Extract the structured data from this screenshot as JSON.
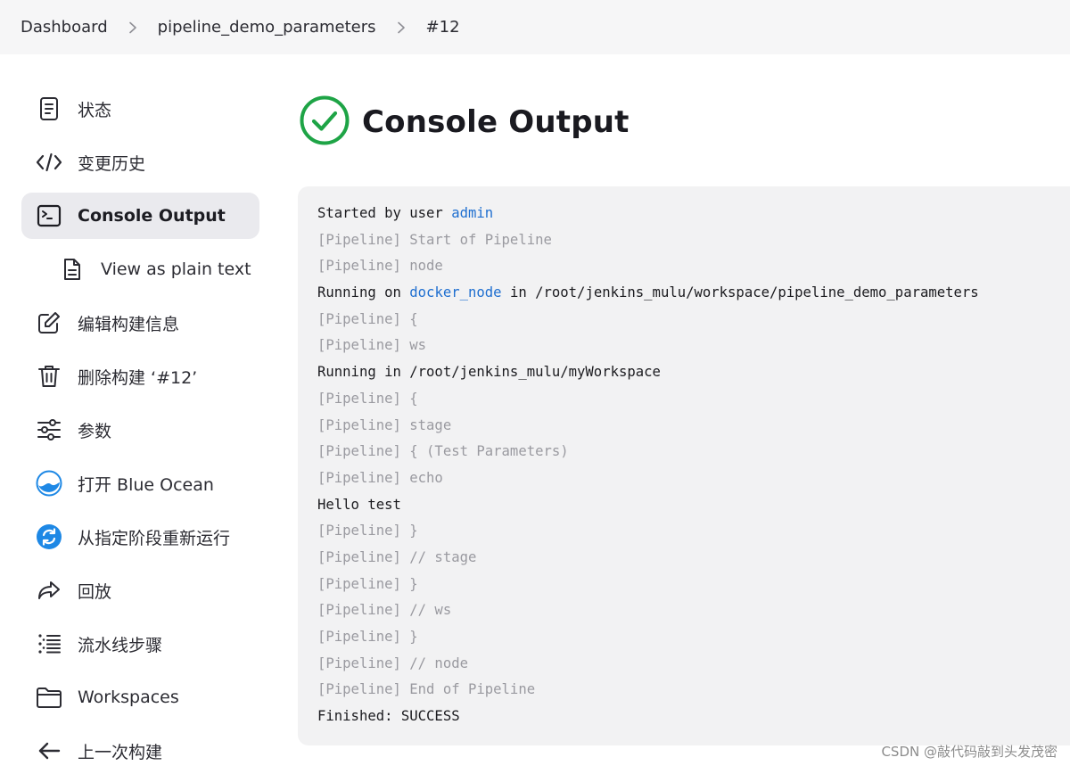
{
  "breadcrumb": {
    "items": [
      "Dashboard",
      "pipeline_demo_parameters",
      "#12"
    ]
  },
  "sidebar": {
    "items": [
      {
        "label": "状态",
        "icon": "document-icon"
      },
      {
        "label": "变更历史",
        "icon": "code-icon"
      },
      {
        "label": "Console Output",
        "icon": "terminal-icon",
        "active": true
      },
      {
        "label": "View as plain text",
        "icon": "file-text-icon",
        "sub": true
      },
      {
        "label": "编辑构建信息",
        "icon": "edit-icon"
      },
      {
        "label": "删除构建 ‘#12’",
        "icon": "trash-icon"
      },
      {
        "label": "参数",
        "icon": "sliders-icon"
      },
      {
        "label": "打开 Blue Ocean",
        "icon": "blue-ocean-icon"
      },
      {
        "label": "从指定阶段重新运行",
        "icon": "restart-icon"
      },
      {
        "label": "回放",
        "icon": "replay-icon"
      },
      {
        "label": "流水线步骤",
        "icon": "list-steps-icon"
      },
      {
        "label": "Workspaces",
        "icon": "folder-icon"
      },
      {
        "label": "上一次构建",
        "icon": "arrow-left-icon"
      }
    ]
  },
  "main": {
    "title": "Console Output",
    "status_icon": "success-check-icon",
    "status_color": "#1ea446"
  },
  "console": {
    "started_prefix": "Started by user ",
    "started_user": "admin",
    "running_on_prefix": "Running on ",
    "running_on_node": "docker_node",
    "running_on_suffix": " in /root/jenkins_mulu/workspace/pipeline_demo_parameters",
    "lines": [
      "[Pipeline] Start of Pipeline",
      "[Pipeline] node",
      "[Pipeline] {",
      "[Pipeline] ws",
      "Running in /root/jenkins_mulu/myWorkspace",
      "[Pipeline] {",
      "[Pipeline] stage",
      "[Pipeline] { (Test Parameters)",
      "[Pipeline] echo",
      "Hello test",
      "[Pipeline] }",
      "[Pipeline] // stage",
      "[Pipeline] }",
      "[Pipeline] // ws",
      "[Pipeline] }",
      "[Pipeline] // node",
      "[Pipeline] End of Pipeline",
      "Finished: SUCCESS"
    ]
  },
  "watermark": "CSDN @敲代码敲到头发茂密",
  "colors": {
    "link": "#1f6fd0",
    "pipeline_text": "#9a9aa0",
    "active_bg": "#eaeaee",
    "console_bg": "#f2f2f3"
  }
}
